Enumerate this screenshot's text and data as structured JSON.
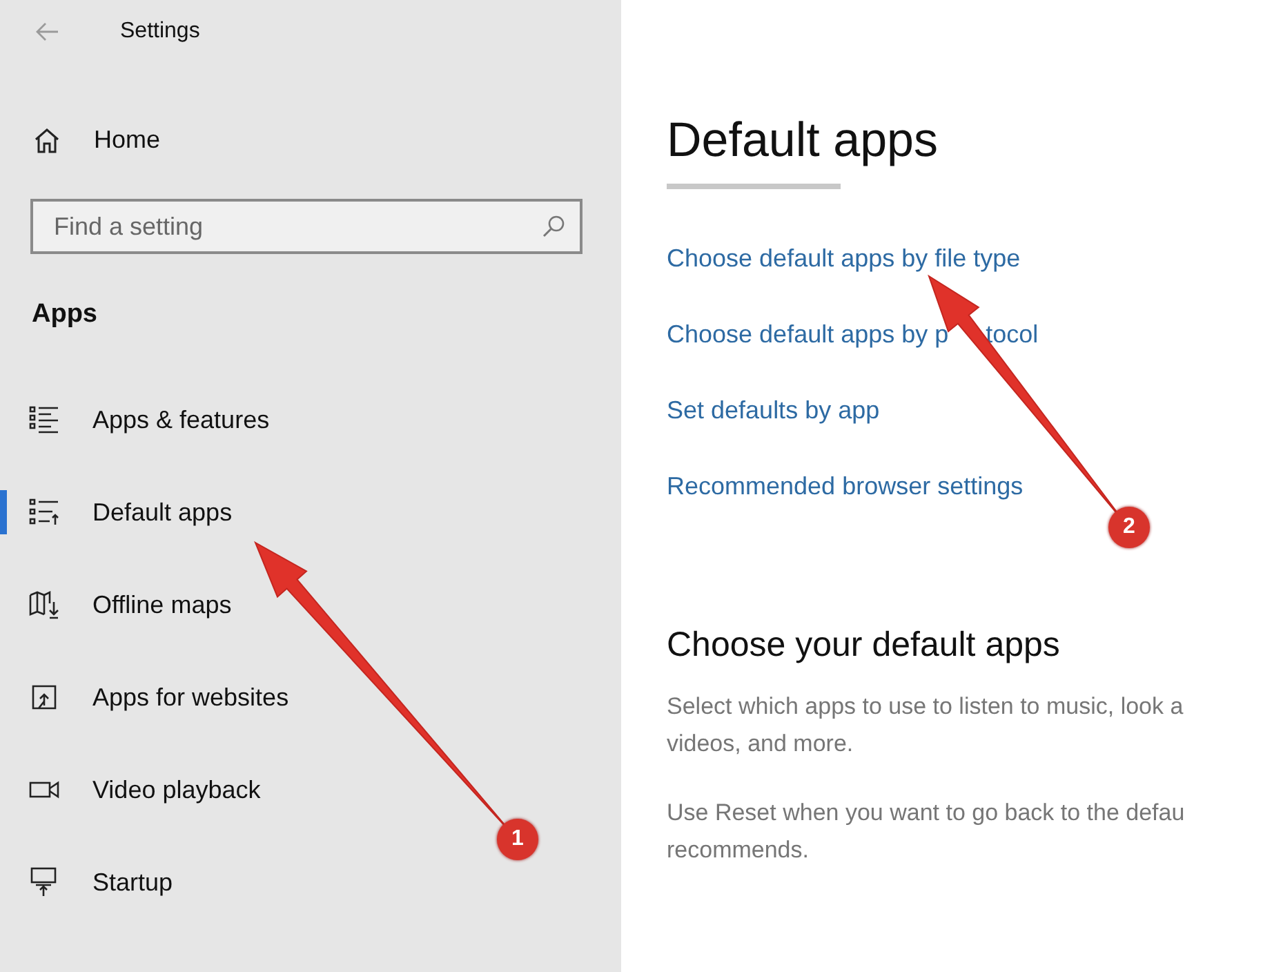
{
  "window": {
    "title": "Settings"
  },
  "sidebar": {
    "home": "Home",
    "search": {
      "placeholder": "Find a setting"
    },
    "section": "Apps",
    "items": [
      {
        "label": "Apps & features",
        "selected": false
      },
      {
        "label": "Default apps",
        "selected": true
      },
      {
        "label": "Offline maps",
        "selected": false
      },
      {
        "label": "Apps for websites",
        "selected": false
      },
      {
        "label": "Video playback",
        "selected": false
      },
      {
        "label": "Startup",
        "selected": false
      }
    ]
  },
  "content": {
    "title": "Default apps",
    "links": [
      [
        "Choose default apps by file type"
      ],
      [
        "Choose default apps by p",
        "tocol"
      ],
      [
        "Set defaults by app"
      ],
      [
        "Recommended browser settings"
      ]
    ],
    "section": "Choose your default apps",
    "paragraphs": [
      [
        "Select which apps to use to listen to music, look a",
        "videos, and more."
      ],
      [
        "Use Reset when you want to go back to the defau",
        "recommends."
      ]
    ]
  },
  "annotations": [
    {
      "number": "1"
    },
    {
      "number": "2"
    }
  ]
}
